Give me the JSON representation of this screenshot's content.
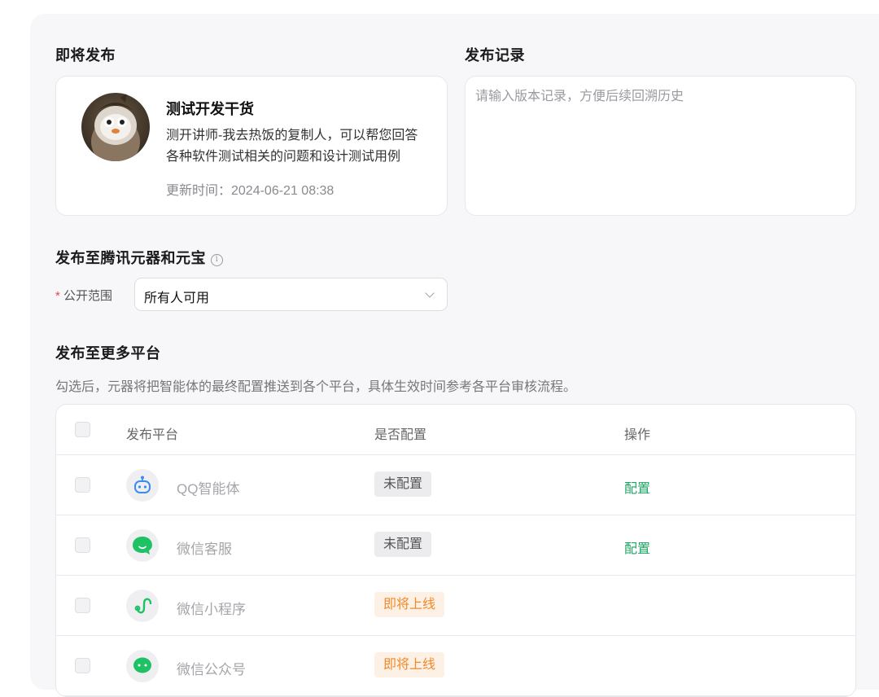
{
  "publish": {
    "title": "即将发布",
    "bot": {
      "name": "测试开发干货",
      "description": "测开讲师-我去热饭的复制人，可以帮您回答各种软件测试相关的问题和设计测试用例",
      "updated": "更新时间：2024-06-21 08:38"
    }
  },
  "record": {
    "title": "发布记录",
    "placeholder": "请输入版本记录，方便后续回溯历史"
  },
  "tencent": {
    "title": "发布至腾讯元器和元宝",
    "info_icon": "info-icon",
    "scope_label": "公开范围",
    "scope_required": "*",
    "scope_value": "所有人可用"
  },
  "platforms": {
    "title": "发布至更多平台",
    "hint": "勾选后，元器将把智能体的最终配置推送到各个平台，具体生效时间参考各平台审核流程。",
    "columns": [
      "发布平台",
      "是否配置",
      "操作"
    ],
    "rows": [
      {
        "name": "QQ智能体",
        "status": "未配置",
        "status_type": "gray",
        "action": "配置",
        "icon": "qq-bot-icon"
      },
      {
        "name": "微信客服",
        "status": "未配置",
        "status_type": "gray",
        "action": "配置",
        "icon": "wechat-service-icon"
      },
      {
        "name": "微信小程序",
        "status": "即将上线",
        "status_type": "orange",
        "action": "",
        "icon": "wechat-miniprogram-icon"
      },
      {
        "name": "微信公众号",
        "status": "即将上线",
        "status_type": "orange",
        "action": "",
        "icon": "wechat-official-account-icon"
      }
    ],
    "colors": {
      "configured_action": "#1fa463",
      "coming_soon": "#f08a2c",
      "wechat_green": "#1ec264",
      "qq_blue": "#3b8cf0"
    }
  }
}
